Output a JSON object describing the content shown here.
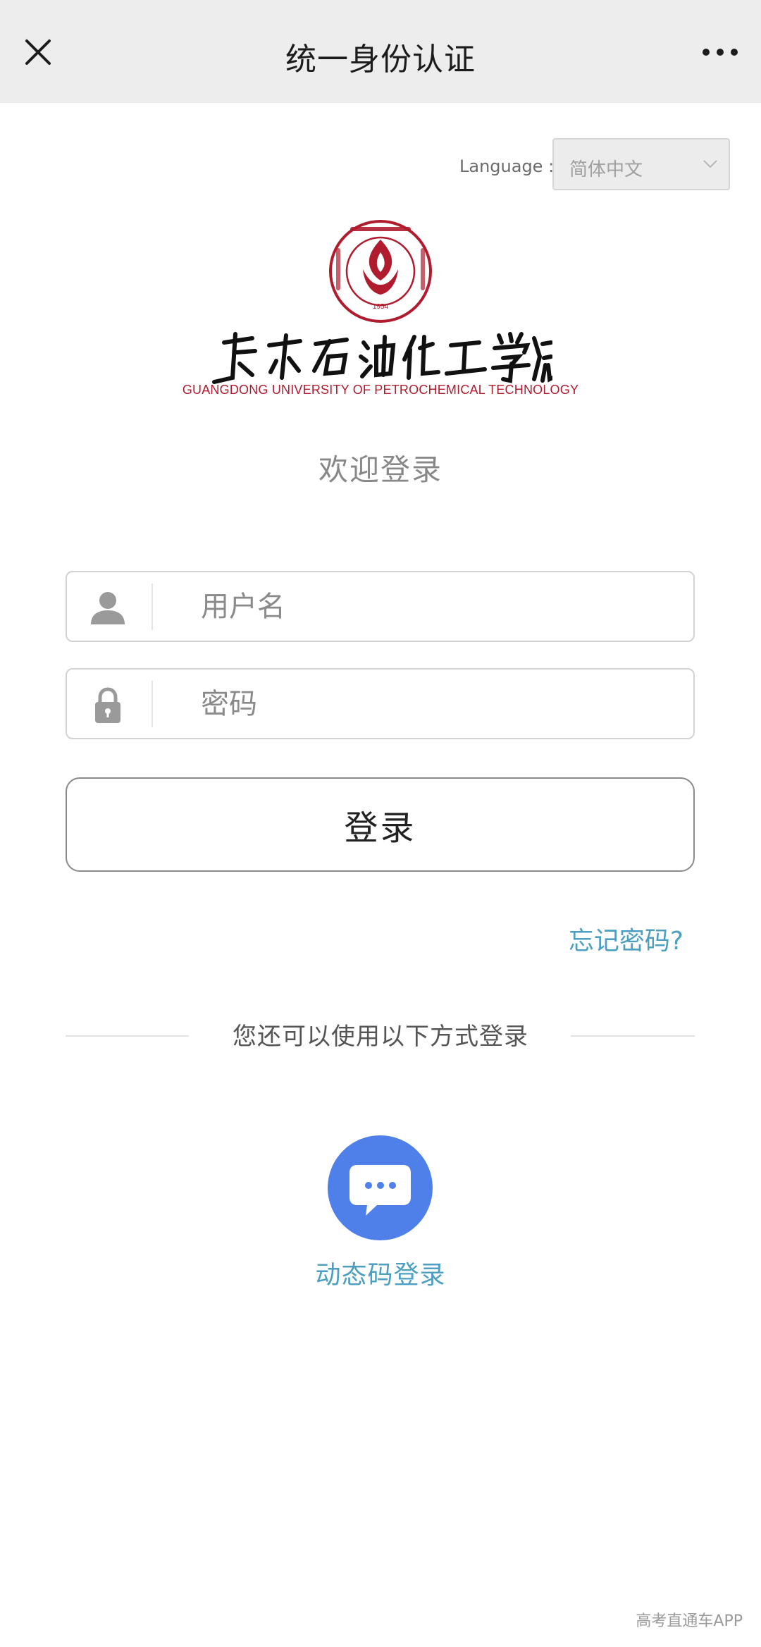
{
  "topbar": {
    "title": "统一身份认证",
    "close_icon": "close-icon",
    "more_icon": "more-horizontal-icon"
  },
  "language": {
    "label": "Language :",
    "selected": "简体中文"
  },
  "logo": {
    "name_cn": "广东石油化工学院",
    "name_en": "GUANGDONG UNIVERSITY OF PETROCHEMICAL TECHNOLOGY",
    "seal_year": "1954",
    "brand_color": "#b01b2e"
  },
  "welcome": "欢迎登录",
  "form": {
    "username_placeholder": "用户名",
    "password_placeholder": "密码",
    "username_icon": "user-icon",
    "password_icon": "lock-icon",
    "login_label": "登录",
    "forgot_label": "忘记密码?"
  },
  "alternatives": {
    "heading": "您还可以使用以下方式登录",
    "otp_label": "动态码登录",
    "otp_icon": "chat-bubble-icon",
    "otp_color": "#4f7fe8"
  },
  "watermark": "高考直通车APP"
}
